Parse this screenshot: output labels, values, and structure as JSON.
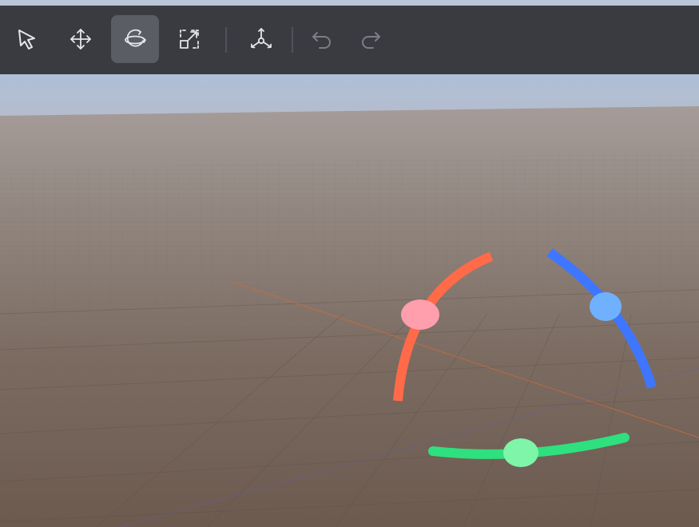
{
  "toolbar": {
    "tools": [
      {
        "name": "select-tool",
        "icon": "cursor-arrow-icon",
        "active": false
      },
      {
        "name": "move-tool",
        "icon": "move-arrows-icon",
        "active": false
      },
      {
        "name": "rotate-tool",
        "icon": "rotate-orbit-icon",
        "active": true
      },
      {
        "name": "scale-tool",
        "icon": "scale-box-icon",
        "active": false
      },
      {
        "name": "local-axes-tool",
        "icon": "axes-pivot-icon",
        "active": false
      },
      {
        "name": "undo-button",
        "icon": "undo-icon",
        "enabled": false
      },
      {
        "name": "redo-button",
        "icon": "redo-icon",
        "enabled": false
      }
    ],
    "colors": {
      "background": "#393b40",
      "active_background": "#5a5d63",
      "icon": "#e4e6ea",
      "icon_disabled": "#7b7e84"
    }
  },
  "viewport": {
    "gizmo": "rotation-gizmo",
    "colors": {
      "sky": "#b3c3da",
      "x_axis": "#ff6a48",
      "y_axis": "#2fe07f",
      "z_axis": "#3f76ff",
      "x_handle": "#ff9eac",
      "y_handle": "#7ef5a8",
      "z_handle": "#6fb1ff"
    }
  }
}
